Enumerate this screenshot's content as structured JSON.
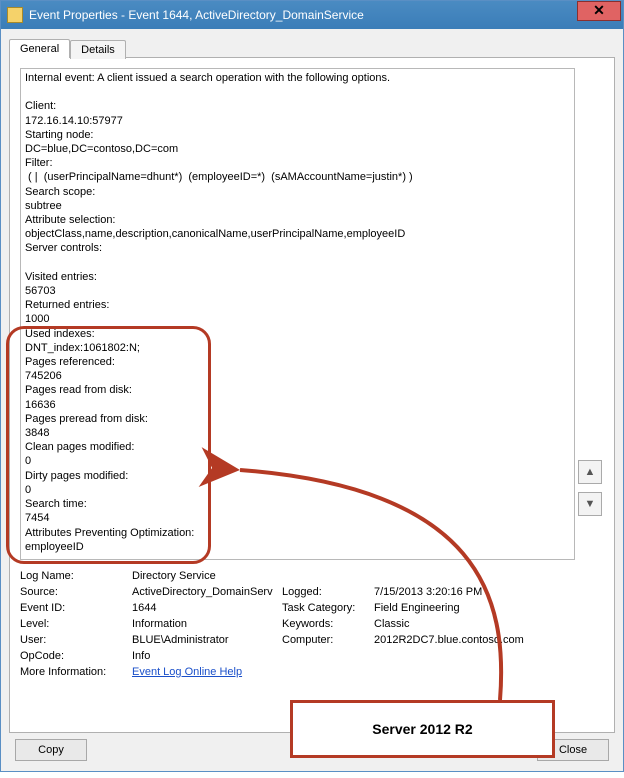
{
  "window": {
    "title": "Event Properties - Event 1644, ActiveDirectory_DomainService",
    "close_glyph": "✕"
  },
  "tabs": {
    "general": "General",
    "details": "Details"
  },
  "detail_lines": [
    "Internal event: A client issued a search operation with the following options.",
    "",
    "Client:",
    "172.16.14.10:57977",
    "Starting node:",
    "DC=blue,DC=contoso,DC=com",
    "Filter:",
    " ( |  (userPrincipalName=dhunt*)  (employeeID=*)  (sAMAccountName=justin*) )",
    "Search scope:",
    "subtree",
    "Attribute selection:",
    "objectClass,name,description,canonicalName,userPrincipalName,employeeID",
    "Server controls:",
    "",
    "Visited entries:",
    "56703",
    "Returned entries:",
    "1000",
    "Used indexes:",
    "DNT_index:1061802:N;",
    "Pages referenced:",
    "745206",
    "Pages read from disk:",
    "16636",
    "Pages preread from disk:",
    "3848",
    "Clean pages modified:",
    "0",
    "Dirty pages modified:",
    "0",
    "Search time:",
    "7454",
    "Attributes Preventing Optimization:",
    "employeeID"
  ],
  "scroll": {
    "up": "▲",
    "down": "▼"
  },
  "meta": {
    "log_name_label": "Log Name:",
    "log_name": "Directory Service",
    "source_label": "Source:",
    "source": "ActiveDirectory_DomainServ",
    "logged_label": "Logged:",
    "logged": "7/15/2013 3:20:16 PM",
    "event_id_label": "Event ID:",
    "event_id": "1644",
    "task_category_label": "Task Category:",
    "task_category": "Field Engineering",
    "level_label": "Level:",
    "level": "Information",
    "keywords_label": "Keywords:",
    "keywords": "Classic",
    "user_label": "User:",
    "user": "BLUE\\Administrator",
    "computer_label": "Computer:",
    "computer": "2012R2DC7.blue.contoso.com",
    "opcode_label": "OpCode:",
    "opcode": "Info",
    "more_info_label": "More Information:",
    "more_info_link": "Event Log Online Help"
  },
  "buttons": {
    "copy": "Copy",
    "close": "Close"
  },
  "annotation_label": "Server 2012 R2"
}
